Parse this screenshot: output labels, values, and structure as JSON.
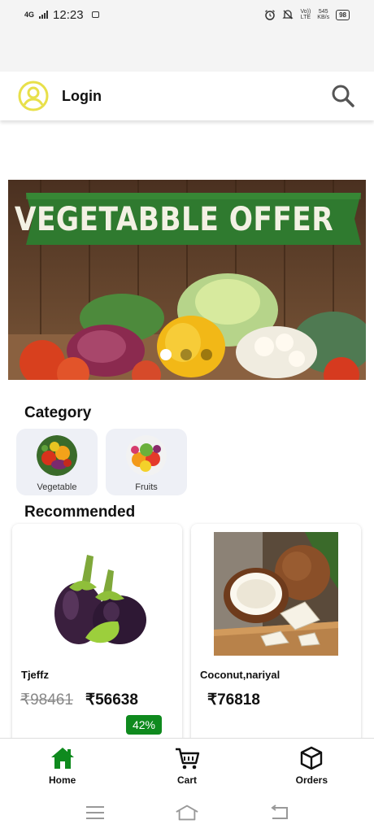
{
  "status_bar": {
    "network": "4G",
    "time": "12:23",
    "speed_value": "545",
    "speed_unit": "KB/s",
    "battery": "98"
  },
  "header": {
    "login_label": "Login",
    "avatar_icon": "user-circle-icon",
    "search_icon": "search-icon",
    "accent_color": "#e8e04a"
  },
  "banner": {
    "title": "VEGETABBLE OFFER",
    "slide_count": 3,
    "active_slide": 1
  },
  "category": {
    "title": "Category",
    "items": [
      {
        "label": "Vegetable"
      },
      {
        "label": "Fruits"
      }
    ]
  },
  "recommended": {
    "title": "Recommended",
    "products": [
      {
        "name": "Tjeffz",
        "old_price": "₹98461",
        "price": "₹56638",
        "discount": "42%"
      },
      {
        "name": "Coconut,nariyal",
        "price": "₹76818"
      }
    ]
  },
  "bottom_nav": {
    "active_color": "#0f8a1e",
    "items": [
      {
        "label": "Home",
        "icon": "home-icon"
      },
      {
        "label": "Cart",
        "icon": "cart-icon"
      },
      {
        "label": "Orders",
        "icon": "box-icon"
      }
    ]
  }
}
